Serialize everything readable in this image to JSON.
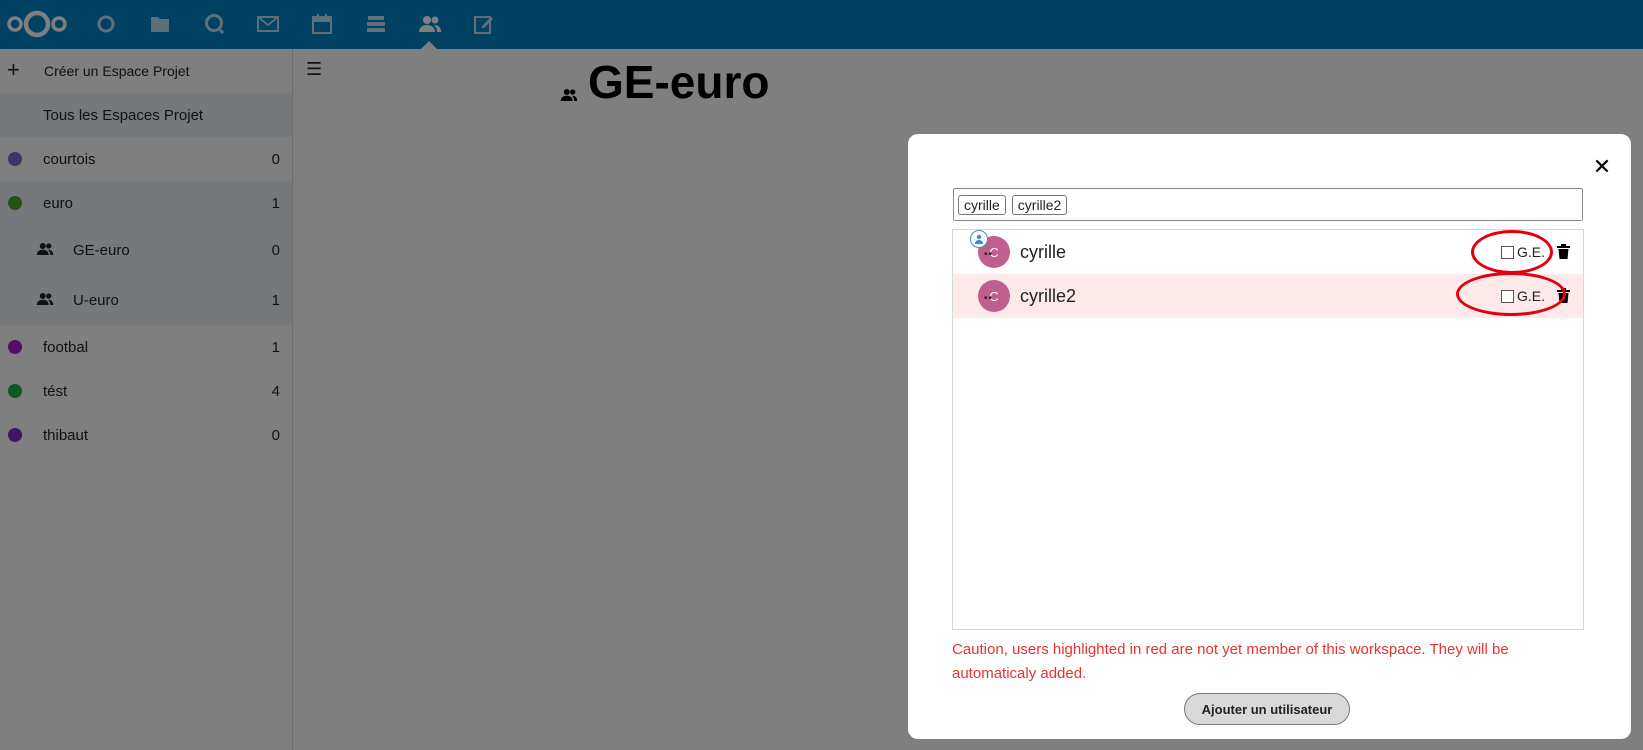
{
  "colors": {
    "topbar": "#0082c9",
    "caution": "#e9322d",
    "ring": "#e4000f",
    "new_member_row": "#fde9ea",
    "avatar": "#c05e8e"
  },
  "topbar": {
    "apps": [
      {
        "icon": "dashboard-icon"
      },
      {
        "icon": "files-icon"
      },
      {
        "icon": "talk-icon"
      },
      {
        "icon": "mail-icon"
      },
      {
        "icon": "calendar-icon"
      },
      {
        "icon": "deck-icon"
      },
      {
        "icon": "workspace-icon",
        "active": true
      },
      {
        "icon": "notes-icon"
      }
    ]
  },
  "sidebar": {
    "create_label": "Créer un Espace Projet",
    "all_label": "Tous les Espaces Projet",
    "items": [
      {
        "label": "courtois",
        "count": "0",
        "color": "#7b6cc0"
      },
      {
        "label": "euro",
        "count": "1",
        "color": "#46a434"
      },
      {
        "label": "GE-euro",
        "count": "0",
        "icon": "group-icon"
      },
      {
        "label": "U-euro",
        "count": "1",
        "icon": "group-icon"
      },
      {
        "label": "footbal",
        "count": "1",
        "color": "#a21fd0"
      },
      {
        "label": "tést",
        "count": "4",
        "color": "#18b14d"
      },
      {
        "label": "thibaut",
        "count": "0",
        "color": "#7a2fc7"
      }
    ]
  },
  "main": {
    "title": "GE-euro"
  },
  "modal": {
    "tags": [
      "cyrille",
      "cyrille2"
    ],
    "users": [
      {
        "name": "cyrille",
        "initial": "C",
        "ge_label": "G.E.",
        "checked": false,
        "new_member": false
      },
      {
        "name": "cyrille2",
        "initial": "C",
        "ge_label": "G.E.",
        "checked": false,
        "new_member": true
      }
    ],
    "caution": "Caution, users highlighted in red are not yet member of this workspace. They will be automaticaly added.",
    "add_button": "Ajouter un utilisateur"
  }
}
